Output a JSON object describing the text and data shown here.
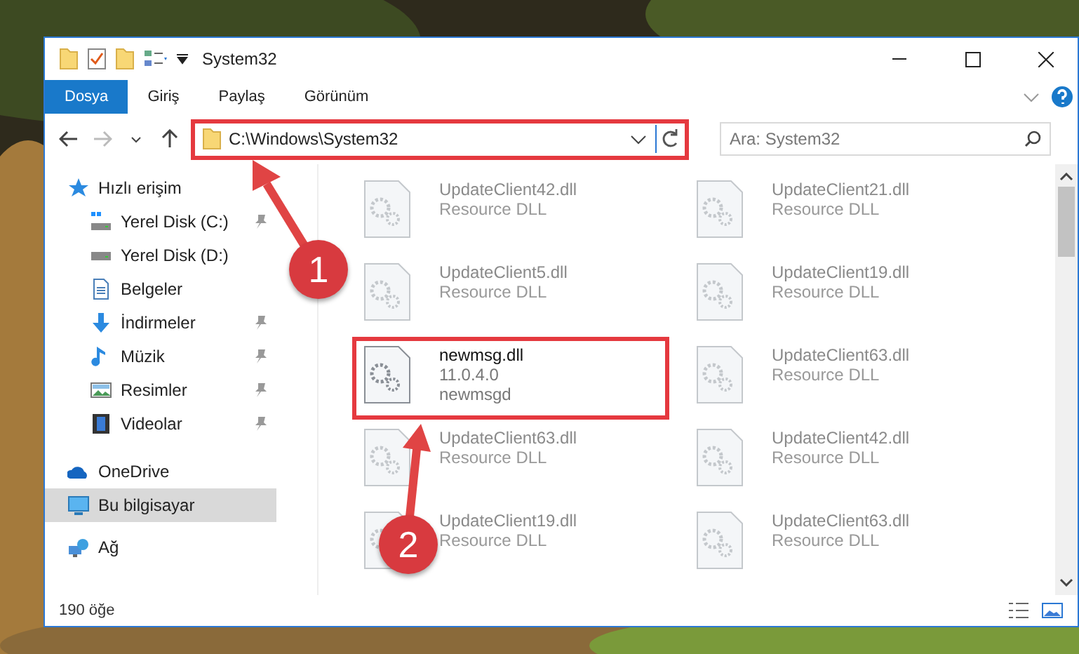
{
  "window": {
    "title": "System32"
  },
  "ribbon": {
    "tabs": [
      {
        "label": "Dosya",
        "selected": true
      },
      {
        "label": "Giriş",
        "selected": false
      },
      {
        "label": "Paylaş",
        "selected": false
      },
      {
        "label": "Görünüm",
        "selected": false
      }
    ]
  },
  "address": {
    "path": "C:\\Windows\\System32",
    "search_placeholder": "Ara: System32",
    "highlighted": true
  },
  "sidebar": {
    "items": [
      {
        "label": "Hızlı erişim",
        "kind": "star",
        "selected": false,
        "children": [
          {
            "label": "Yerel Disk (C:)",
            "kind": "windrive",
            "pinned": true,
            "selected": false
          },
          {
            "label": "Yerel Disk (D:)",
            "kind": "drive",
            "pinned": false,
            "selected": false
          },
          {
            "label": "Belgeler",
            "kind": "document",
            "pinned": false,
            "selected": false
          },
          {
            "label": "İndirmeler",
            "kind": "download",
            "pinned": true,
            "selected": false
          },
          {
            "label": "Müzik",
            "kind": "music",
            "pinned": true,
            "selected": false
          },
          {
            "label": "Resimler",
            "kind": "pictures",
            "pinned": true,
            "selected": false
          },
          {
            "label": "Videolar",
            "kind": "video",
            "pinned": true,
            "selected": false
          }
        ]
      },
      {
        "label": "OneDrive",
        "kind": "cloud",
        "selected": false
      },
      {
        "label": "Bu bilgisayar",
        "kind": "computer",
        "selected": true
      },
      {
        "label": "Ağ",
        "kind": "network",
        "selected": false
      }
    ]
  },
  "files": [
    {
      "name": "UpdateClient42.dll",
      "detail_1": "Resource DLL",
      "blurred": true,
      "highlighted": false
    },
    {
      "name": "UpdateClient21.dll",
      "detail_1": "Resource DLL",
      "blurred": true,
      "highlighted": false
    },
    {
      "name": "UpdateClient5.dll",
      "detail_1": "Resource DLL",
      "blurred": true,
      "highlighted": false
    },
    {
      "name": "UpdateClient19.dll",
      "detail_1": "Resource DLL",
      "blurred": true,
      "highlighted": false
    },
    {
      "name": "newmsg.dll",
      "detail_1": "11.0.4.0",
      "detail_2": "newmsgd",
      "blurred": false,
      "highlighted": true
    },
    {
      "name": "UpdateClient63.dll",
      "detail_1": "Resource DLL",
      "blurred": true,
      "highlighted": false
    },
    {
      "name": "UpdateClient63.dll",
      "detail_1": "Resource DLL",
      "blurred": true,
      "highlighted": false
    },
    {
      "name": "UpdateClient42.dll",
      "detail_1": "Resource DLL",
      "blurred": true,
      "highlighted": false
    },
    {
      "name": "UpdateClient19.dll",
      "detail_1": "Resource DLL",
      "blurred": true,
      "highlighted": false
    },
    {
      "name": "UpdateClient63.dll",
      "detail_1": "Resource DLL",
      "blurred": true,
      "highlighted": false
    }
  ],
  "status_bar": {
    "count": "190 öğe"
  },
  "annotations": [
    {
      "label": "1"
    },
    {
      "label": "2"
    }
  ]
}
